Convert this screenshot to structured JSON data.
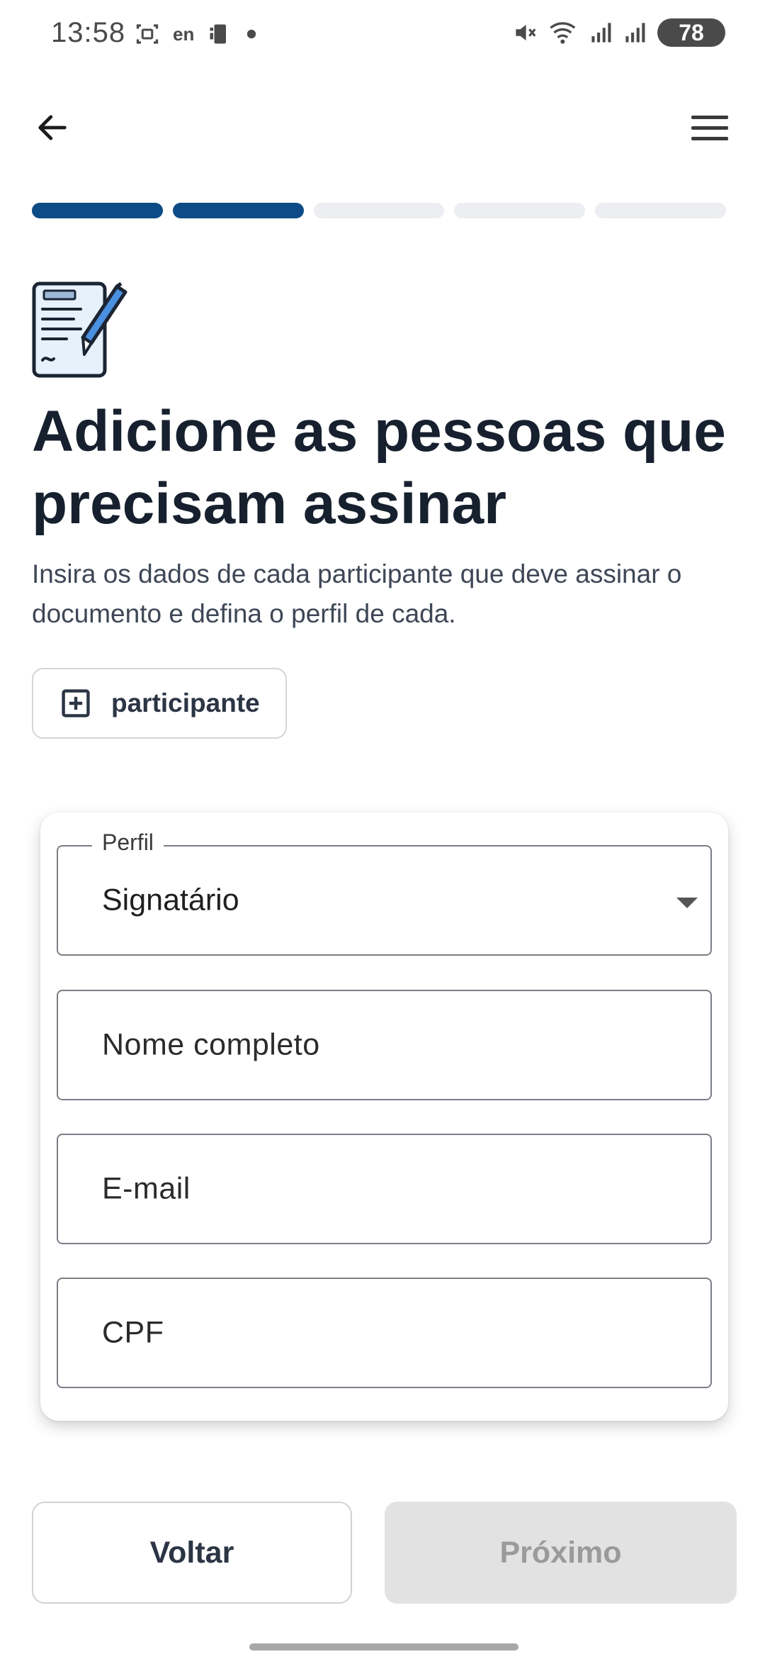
{
  "status_bar": {
    "time": "13:58",
    "lang": "en",
    "battery": "78",
    "icons": [
      "screenshot-icon",
      "language-icon",
      "phone-icon",
      "dot-icon",
      "mute-icon",
      "wifi-icon",
      "signal-icon",
      "signal-icon",
      "battery-icon"
    ]
  },
  "app_bar": {
    "back_icon": "arrow-left-icon",
    "menu_icon": "hamburger-menu-icon"
  },
  "progress": {
    "total_steps": 5,
    "completed_steps": 2,
    "active_color": "#0d4b86",
    "inactive_color": "#eceef2"
  },
  "header": {
    "icon": "document-signature-icon",
    "title": "Adicione as pessoas que precisam assinar",
    "subtitle": "Insira os dados de cada participante que deve assinar o documento e defina o perfil de cada."
  },
  "add_participant": {
    "icon": "plus-square-icon",
    "label": "participante"
  },
  "form": {
    "perfil": {
      "label": "Perfil",
      "value": "Signatário"
    },
    "nome": {
      "placeholder": "Nome completo"
    },
    "email": {
      "placeholder": "E-mail"
    },
    "cpf": {
      "placeholder": "CPF"
    }
  },
  "footer": {
    "back_label": "Voltar",
    "next_label": "Próximo"
  }
}
